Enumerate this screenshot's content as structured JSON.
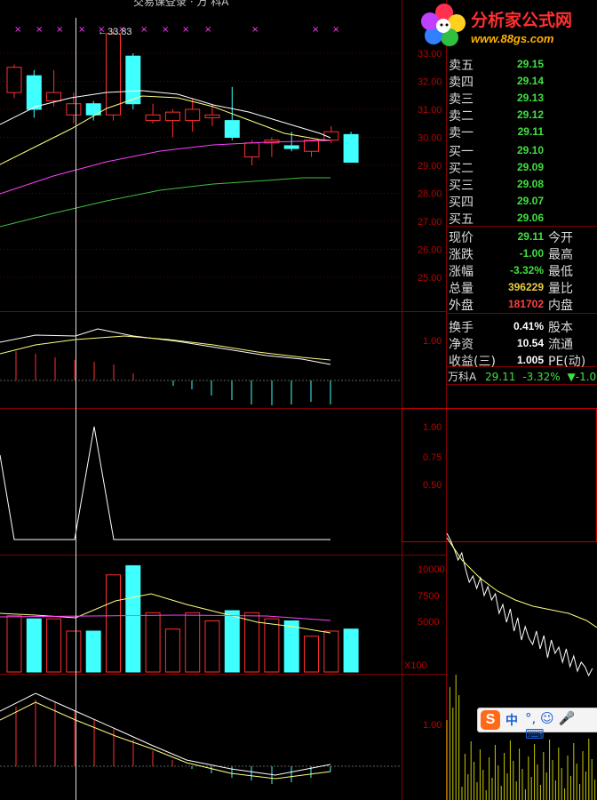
{
  "window": {
    "title_fragment": "交易课登录 · 万 科A"
  },
  "logo": {
    "name": "分析家公式网",
    "url": "www.88gs.com"
  },
  "price_axis": {
    "ticks": [
      "33.00",
      "32.00",
      "31.00",
      "30.00",
      "29.00",
      "28.00",
      "27.00",
      "26.00",
      "25.00"
    ],
    "high_label": "33.83"
  },
  "macd_axis": {
    "ticks": [
      "1.00"
    ]
  },
  "panel3_axis": {
    "ticks": [
      "1.00",
      "0.75",
      "0.50"
    ]
  },
  "volume_axis": {
    "ticks": [
      "10000",
      "7500",
      "5000"
    ],
    "unit": "X100"
  },
  "panel5_axis": {
    "ticks": [
      "1.00"
    ]
  },
  "order_book": {
    "asks": [
      {
        "label": "卖五",
        "price": "29.15"
      },
      {
        "label": "卖四",
        "price": "29.14"
      },
      {
        "label": "卖三",
        "price": "29.13"
      },
      {
        "label": "卖二",
        "price": "29.12"
      },
      {
        "label": "卖一",
        "price": "29.11"
      }
    ],
    "bids": [
      {
        "label": "买一",
        "price": "29.10"
      },
      {
        "label": "买二",
        "price": "29.09"
      },
      {
        "label": "买三",
        "price": "29.08"
      },
      {
        "label": "买四",
        "price": "29.07"
      },
      {
        "label": "买五",
        "price": "29.06"
      }
    ]
  },
  "quote": {
    "rows": [
      {
        "label": "现价",
        "value": "29.11",
        "color": "#40e040",
        "right": "今开"
      },
      {
        "label": "涨跌",
        "value": "-1.00",
        "color": "#40e040",
        "right": "最高"
      },
      {
        "label": "涨幅",
        "value": "-3.32%",
        "color": "#40e040",
        "right": "最低"
      },
      {
        "label": "总量",
        "value": "396229",
        "color": "#e8d040",
        "right": "量比"
      },
      {
        "label": "外盘",
        "value": "181702",
        "color": "#ff4040",
        "right": "内盘"
      },
      {
        "label": "换手",
        "value": "0.41%",
        "color": "#ffffff",
        "right": "股本"
      },
      {
        "label": "净资",
        "value": "10.54",
        "color": "#ffffff",
        "right": "流通"
      },
      {
        "label": "收益(三)",
        "value": "1.005",
        "color": "#ffffff",
        "right": "PE(动)"
      }
    ]
  },
  "stock_bar": {
    "name": "万科A",
    "price": "29.11",
    "change_pct": "-3.32%",
    "change": "▼-1.00"
  },
  "ime": {
    "logo": "S",
    "lang": "中",
    "icons": "°, ☺ 🎤 ⌨"
  },
  "colors": {
    "up": "#ff3030",
    "down": "#40ffff",
    "grid": "#800000",
    "ma_white": "#ffffff",
    "ma_yellow": "#ffff80",
    "ma_magenta": "#ff40ff",
    "ma_green": "#40c040"
  },
  "chart_data": {
    "type": "candlestick",
    "candles": [
      {
        "open": 31.6,
        "close": 32.5,
        "high": 32.6,
        "low": 31.4
      },
      {
        "open": 32.2,
        "close": 31.0,
        "high": 32.4,
        "low": 30.7
      },
      {
        "open": 31.3,
        "close": 31.6,
        "high": 32.4,
        "low": 31.1
      },
      {
        "open": 30.8,
        "close": 31.2,
        "high": 31.6,
        "low": 30.5
      },
      {
        "open": 31.2,
        "close": 30.8,
        "high": 31.3,
        "low": 30.6
      },
      {
        "open": 30.8,
        "close": 33.7,
        "high": 33.83,
        "low": 30.6
      },
      {
        "open": 32.9,
        "close": 31.2,
        "high": 33.0,
        "low": 31.0
      },
      {
        "open": 30.6,
        "close": 30.8,
        "high": 31.2,
        "low": 30.5
      },
      {
        "open": 30.6,
        "close": 30.9,
        "high": 31.0,
        "low": 30.0
      },
      {
        "open": 30.6,
        "close": 31.0,
        "high": 31.4,
        "low": 30.2
      },
      {
        "open": 30.7,
        "close": 30.8,
        "high": 31.2,
        "low": 30.4
      },
      {
        "open": 30.6,
        "close": 30.0,
        "high": 31.8,
        "low": 29.9
      },
      {
        "open": 29.3,
        "close": 29.8,
        "high": 29.9,
        "low": 29.0
      },
      {
        "open": 29.8,
        "close": 29.9,
        "high": 30.0,
        "low": 29.3
      },
      {
        "open": 29.7,
        "close": 29.6,
        "high": 30.2,
        "low": 29.5
      },
      {
        "open": 29.5,
        "close": 29.9,
        "high": 29.9,
        "low": 29.3
      },
      {
        "open": 29.9,
        "close": 30.2,
        "high": 30.4,
        "low": 29.8
      },
      {
        "open": 30.1,
        "close": 29.11,
        "high": 30.2,
        "low": 29.1
      }
    ],
    "volume": [
      5500,
      5200,
      5200,
      4000,
      4000,
      9500,
      10400,
      5800,
      4200,
      5800,
      5000,
      6000,
      5800,
      5200,
      5000,
      3500,
      4000,
      4200
    ]
  }
}
